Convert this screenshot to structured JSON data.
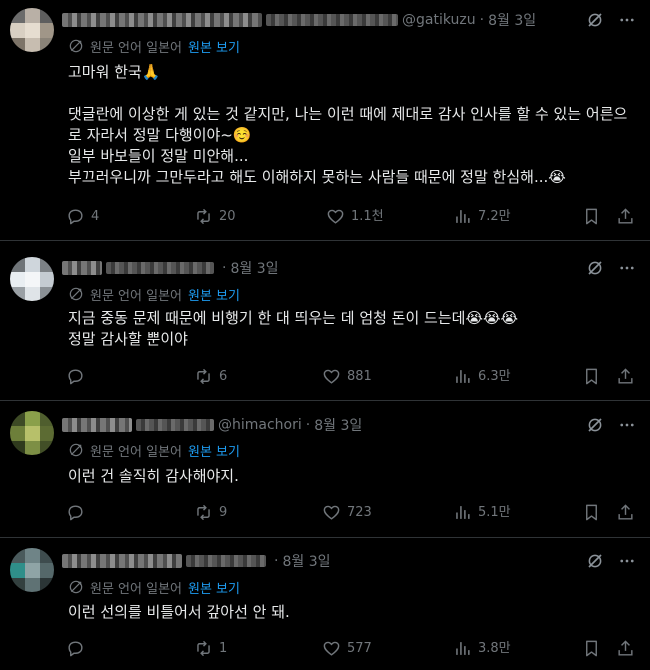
{
  "common": {
    "translated_from": "원문 언어 일본어",
    "show_original": "원본 보기"
  },
  "replies": [
    {
      "handle": "@gatikuzu",
      "date": "8월 3일",
      "text": "고마워 한국🙏\n\n댓글란에 이상한 게 있는 것 같지만, 나는 이런 때에 제대로 감사 인사를 할 수 있는 어른으로 자라서 정말 다행이야~☺️\n일부 바보들이 정말 미안해...\n부끄러우니까 그만두라고 해도 이해하지 못하는 사람들 때문에 정말 한심해...😭",
      "replies": "4",
      "reposts": "20",
      "likes": "1.1천",
      "views": "7.2만"
    },
    {
      "handle": "",
      "date": "8월 3일",
      "text": "지금 중동 문제 때문에 비행기 한 대 띄우는 데 엄청 돈이 드는데😭😭😭\n정말 감사할 뿐이야",
      "replies": "",
      "reposts": "6",
      "likes": "881",
      "views": "6.3만"
    },
    {
      "handle": "@himachori",
      "date": "8월 3일",
      "text": "이런 건 솔직히 감사해야지.",
      "replies": "",
      "reposts": "9",
      "likes": "723",
      "views": "5.1만"
    },
    {
      "handle": "",
      "date": "8월 3일",
      "text": "이런 선의를 비틀어서 갚아선 안 돼.",
      "replies": "",
      "reposts": "1",
      "likes": "577",
      "views": "3.8만"
    }
  ],
  "icons": {
    "grok": "grok-icon",
    "more": "more-icon",
    "reply": "reply-icon",
    "repost": "repost-icon",
    "like": "like-icon",
    "views": "views-icon",
    "bookmark": "bookmark-icon",
    "share": "share-icon",
    "translate": "translate-icon"
  }
}
